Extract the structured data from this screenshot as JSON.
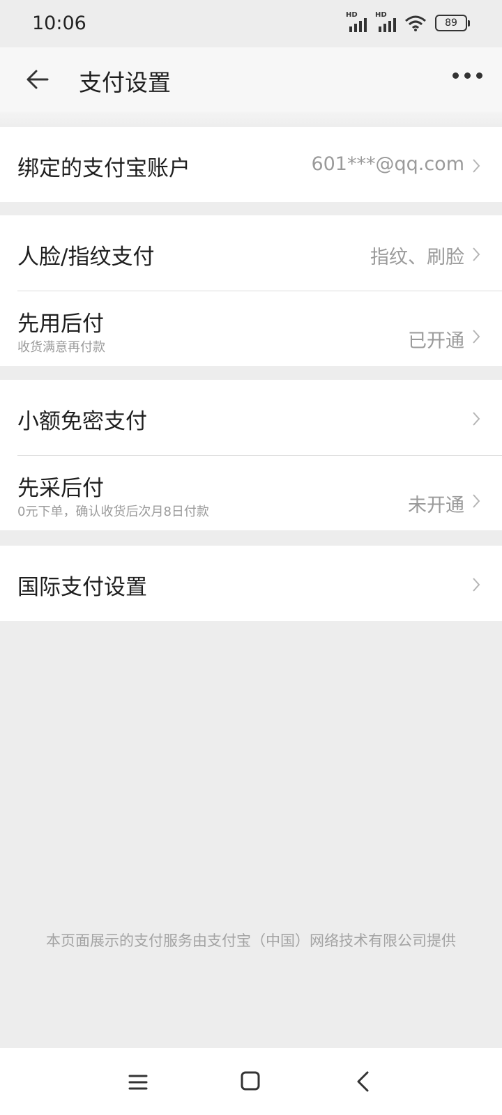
{
  "status_bar": {
    "time": "10:06",
    "signal_label_1": "HD",
    "signal_label_2": "HD",
    "battery": "89"
  },
  "nav": {
    "title": "支付设置",
    "back_icon": "back-arrow-icon",
    "more_icon": "more-dots-icon"
  },
  "groups": [
    {
      "rows": [
        {
          "title": "绑定的支付宝账户",
          "subtitle": "",
          "value": "601***@qq.com"
        }
      ]
    },
    {
      "rows": [
        {
          "title": "人脸/指纹支付",
          "subtitle": "",
          "value": "指纹、刷脸"
        },
        {
          "title": "先用后付",
          "subtitle": "收货满意再付款",
          "value": "已开通"
        }
      ]
    },
    {
      "rows": [
        {
          "title": "小额免密支付",
          "subtitle": "",
          "value": ""
        },
        {
          "title": "先采后付",
          "subtitle": "0元下单，确认收货后次月8日付款",
          "value": "未开通"
        }
      ]
    },
    {
      "rows": [
        {
          "title": "国际支付设置",
          "subtitle": "",
          "value": ""
        }
      ]
    }
  ],
  "footer_note": "本页面展示的支付服务由支付宝（中国）网络技术有限公司提供",
  "system_nav": {
    "menu_icon": "menu-icon",
    "home_icon": "home-icon",
    "back_icon": "back-icon"
  }
}
